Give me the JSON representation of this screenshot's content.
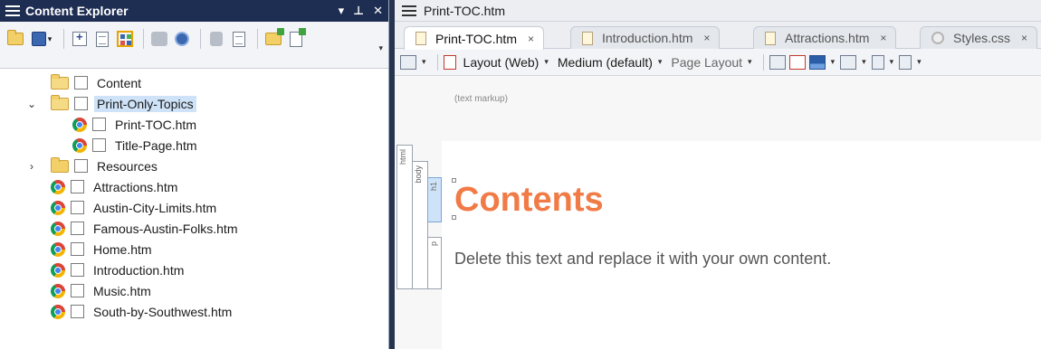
{
  "content_explorer": {
    "title": "Content Explorer",
    "controls": {
      "dropdown": "▾",
      "pin": "⊥",
      "close": "✕"
    },
    "tree": [
      {
        "label": "Content",
        "type": "folder-open",
        "indent": 0,
        "expander": ""
      },
      {
        "label": "Print-Only-Topics",
        "type": "folder-open",
        "indent": 1,
        "expander": "⌄",
        "selected": true
      },
      {
        "label": "Print-TOC.htm",
        "type": "topic",
        "indent": 2,
        "expander": ""
      },
      {
        "label": "Title-Page.htm",
        "type": "topic",
        "indent": 2,
        "expander": ""
      },
      {
        "label": "Resources",
        "type": "folder",
        "indent": 1,
        "expander": "›"
      },
      {
        "label": "Attractions.htm",
        "type": "topic",
        "indent": 1,
        "expander": ""
      },
      {
        "label": "Austin-City-Limits.htm",
        "type": "topic",
        "indent": 1,
        "expander": ""
      },
      {
        "label": "Famous-Austin-Folks.htm",
        "type": "topic",
        "indent": 1,
        "expander": ""
      },
      {
        "label": "Home.htm",
        "type": "topic",
        "indent": 1,
        "expander": ""
      },
      {
        "label": "Introduction.htm",
        "type": "topic",
        "indent": 1,
        "expander": ""
      },
      {
        "label": "Music.htm",
        "type": "topic",
        "indent": 1,
        "expander": ""
      },
      {
        "label": "South-by-Southwest.htm",
        "type": "topic",
        "indent": 1,
        "expander": ""
      }
    ]
  },
  "editor": {
    "doc_title": "Print-TOC.htm",
    "tabs": [
      {
        "label": "Print-TOC.htm",
        "close": "×",
        "active": true
      },
      {
        "label": "Introduction.htm",
        "close": "×",
        "active": false
      },
      {
        "label": "Attractions.htm",
        "close": "×",
        "active": false
      },
      {
        "label": "Styles.css",
        "close": "×",
        "active": false
      }
    ],
    "toolbar": {
      "layout": "Layout (Web)",
      "medium": "Medium (default)",
      "page_layout": "Page Layout"
    },
    "markup_label": "(text markup)",
    "structure_bars": {
      "html": "html",
      "body": "body",
      "h1": "h1",
      "p": "p"
    },
    "heading": "Contents",
    "paragraph": "Delete this text and replace it with your own content."
  },
  "colors": {
    "pane_title_bg": "#1e2d52",
    "heading": "#f07b47",
    "callout_arrow": "#f0522a",
    "selection": "#cfe3f8"
  }
}
